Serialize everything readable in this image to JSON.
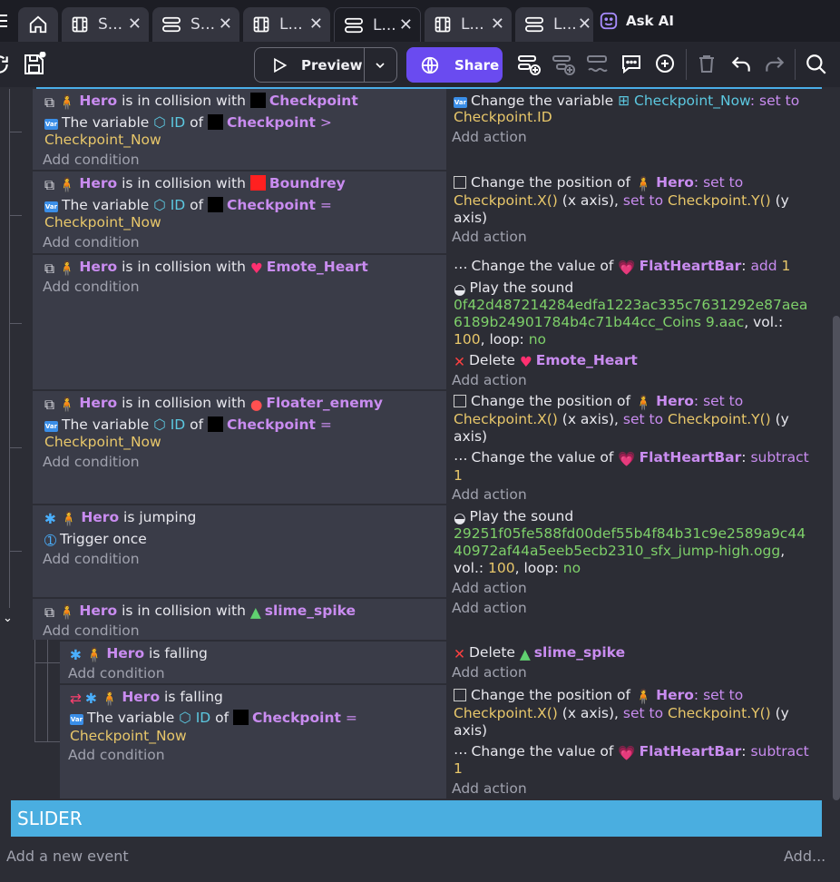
{
  "tabs": [
    {
      "label": "S...",
      "kind": "film"
    },
    {
      "label": "S...",
      "kind": "layers"
    },
    {
      "label": "L...",
      "kind": "film"
    },
    {
      "label": "L...",
      "kind": "layers",
      "active": true
    },
    {
      "label": "L...",
      "kind": "film"
    },
    {
      "label": "L...",
      "kind": "layers"
    }
  ],
  "ask_ai": "Ask AI",
  "toolbar": {
    "preview": "Preview",
    "share": "Share"
  },
  "events": [
    {
      "conditions": [
        {
          "parts": [
            [
              "Hero",
              "obj"
            ],
            [
              " is in collision with ",
              ""
            ],
            [
              "Checkpoint",
              "obj"
            ]
          ]
        },
        {
          "parts": [
            [
              "The variable ",
              ""
            ],
            [
              "ID",
              "cyan"
            ],
            [
              " of ",
              ""
            ],
            [
              "Checkpoint",
              "obj"
            ],
            [
              " >",
              "kw"
            ]
          ],
          "cont": [
            [
              "Checkpoint_Now",
              "val"
            ]
          ]
        }
      ],
      "actions": [
        {
          "parts": [
            [
              "Change the variable ",
              ""
            ],
            [
              "Checkpoint_Now",
              "cyan"
            ],
            [
              ": set to",
              "kw"
            ]
          ],
          "cont": [
            [
              "Checkpoint.ID",
              "val"
            ]
          ]
        }
      ]
    },
    {
      "conditions": [
        {
          "parts": [
            [
              "Hero",
              "obj"
            ],
            [
              " is in collision with ",
              ""
            ],
            [
              "Boundrey",
              "obj"
            ]
          ]
        },
        {
          "parts": [
            [
              "The variable ",
              ""
            ],
            [
              "ID",
              "cyan"
            ],
            [
              " of ",
              ""
            ],
            [
              "Checkpoint",
              "obj"
            ],
            [
              " =",
              "kw"
            ]
          ],
          "cont": [
            [
              "Checkpoint_Now",
              "val"
            ]
          ]
        }
      ],
      "actions": [
        {
          "parts": [
            [
              "Change the position of ",
              ""
            ],
            [
              "Hero",
              "obj"
            ],
            [
              ": set to",
              "kw"
            ]
          ],
          "cont": [
            [
              "Checkpoint.X()",
              "val"
            ],
            [
              " (x axis), ",
              ""
            ],
            [
              "set to ",
              "kw"
            ],
            [
              "Checkpoint.Y()",
              "val"
            ],
            [
              " (y",
              ""
            ]
          ],
          "cont2": [
            [
              "axis)",
              ""
            ]
          ]
        }
      ]
    },
    {
      "conditions": [
        {
          "parts": [
            [
              "Hero",
              "obj"
            ],
            [
              " is in collision with ",
              ""
            ],
            [
              "Emote_Heart",
              "obj"
            ]
          ]
        }
      ],
      "actions": [
        {
          "parts": [
            [
              "Change the value of ",
              ""
            ],
            [
              "FlatHeartBar",
              "obj"
            ],
            [
              ": ",
              ""
            ],
            [
              "add ",
              "kw"
            ],
            [
              "1",
              "num"
            ]
          ]
        },
        {
          "parts": [
            [
              "Play the sound",
              ""
            ]
          ],
          "cont": [
            [
              "0f42d487214284edfa1223ac335c7631292e87aea",
              "green"
            ]
          ],
          "cont2": [
            [
              "6189b24901784b4c71b44cc_Coins 9.aac",
              "green"
            ],
            [
              ", vol.:",
              ""
            ]
          ],
          "cont3": [
            [
              "100",
              "num"
            ],
            [
              ", loop: ",
              ""
            ],
            [
              "no",
              "green"
            ]
          ]
        },
        {
          "parts": [
            [
              "Delete ",
              ""
            ],
            [
              "Emote_Heart",
              "obj"
            ]
          ]
        }
      ]
    },
    {
      "conditions": [
        {
          "parts": [
            [
              "Hero",
              "obj"
            ],
            [
              " is in collision with ",
              ""
            ],
            [
              "Floater_enemy",
              "obj"
            ]
          ]
        },
        {
          "parts": [
            [
              "The variable ",
              ""
            ],
            [
              "ID",
              "cyan"
            ],
            [
              " of ",
              ""
            ],
            [
              "Checkpoint",
              "obj"
            ],
            [
              " =",
              "kw"
            ]
          ],
          "cont": [
            [
              "Checkpoint_Now",
              "val"
            ]
          ]
        }
      ],
      "actions": [
        {
          "parts": [
            [
              "Change the position of ",
              ""
            ],
            [
              "Hero",
              "obj"
            ],
            [
              ": set to",
              "kw"
            ]
          ],
          "cont": [
            [
              "Checkpoint.X()",
              "val"
            ],
            [
              " (x axis), ",
              ""
            ],
            [
              "set to ",
              "kw"
            ],
            [
              "Checkpoint.Y()",
              "val"
            ],
            [
              " (y",
              ""
            ]
          ],
          "cont2": [
            [
              "axis)",
              ""
            ]
          ]
        },
        {
          "parts": [
            [
              "Change the value of ",
              ""
            ],
            [
              "FlatHeartBar",
              "obj"
            ],
            [
              ": ",
              ""
            ],
            [
              "subtract",
              "kw"
            ]
          ],
          "cont": [
            [
              "1",
              "num"
            ]
          ]
        }
      ]
    },
    {
      "conditions": [
        {
          "parts": [
            [
              "Hero",
              "obj"
            ],
            [
              " is jumping",
              ""
            ]
          ]
        },
        {
          "parts": [
            [
              "Trigger once",
              ""
            ]
          ]
        }
      ],
      "actions": [
        {
          "parts": [
            [
              "Play the sound",
              ""
            ]
          ],
          "cont": [
            [
              "29251f05fe588fd00def55b4f84b31c9e2589a9c44",
              "green"
            ]
          ],
          "cont2": [
            [
              "40972af44a5eeb5ecb2310_sfx_jump-high.ogg",
              "green"
            ],
            [
              ",",
              ""
            ]
          ],
          "cont3": [
            [
              "vol.: ",
              ""
            ],
            [
              "100",
              "num"
            ],
            [
              ", loop: ",
              ""
            ],
            [
              "no",
              "green"
            ]
          ]
        }
      ]
    },
    {
      "conditions": [
        {
          "parts": [
            [
              "Hero",
              "obj"
            ],
            [
              " is in collision with ",
              ""
            ],
            [
              "slime_spike",
              "obj"
            ]
          ]
        }
      ],
      "actions": []
    },
    {
      "conditions": [
        {
          "parts": [
            [
              "Hero",
              "obj"
            ],
            [
              " is falling",
              ""
            ]
          ]
        }
      ],
      "actions": [
        {
          "parts": [
            [
              "Delete ",
              ""
            ],
            [
              "slime_spike",
              "obj"
            ]
          ]
        }
      ]
    },
    {
      "conditions": [
        {
          "parts": [
            [
              "Hero",
              "obj"
            ],
            [
              " is falling",
              ""
            ]
          ]
        },
        {
          "parts": [
            [
              "The variable ",
              ""
            ],
            [
              "ID",
              "cyan"
            ],
            [
              " of ",
              ""
            ],
            [
              "Checkpoint",
              "obj"
            ],
            [
              " =",
              "kw"
            ]
          ],
          "cont": [
            [
              "Checkpoint_Now",
              "val"
            ]
          ]
        }
      ],
      "actions": [
        {
          "parts": [
            [
              "Change the position of ",
              ""
            ],
            [
              "Hero",
              "obj"
            ],
            [
              ": set to",
              "kw"
            ]
          ],
          "cont": [
            [
              "Checkpoint.X()",
              "val"
            ],
            [
              " (x axis), ",
              ""
            ],
            [
              "set to ",
              "kw"
            ],
            [
              "Checkpoint.Y()",
              "val"
            ],
            [
              " (y",
              ""
            ]
          ],
          "cont2": [
            [
              "axis)",
              ""
            ]
          ]
        },
        {
          "parts": [
            [
              "Change the value of ",
              ""
            ],
            [
              "FlatHeartBar",
              "obj"
            ],
            [
              ": ",
              ""
            ],
            [
              "subtract",
              "kw"
            ]
          ],
          "cont": [
            [
              "1",
              "num"
            ]
          ]
        }
      ]
    }
  ],
  "add_condition": "Add condition",
  "add_action": "Add action",
  "group_label": "SLIDER",
  "footer": {
    "add_event": "Add a new event",
    "add_more": "Add..."
  }
}
